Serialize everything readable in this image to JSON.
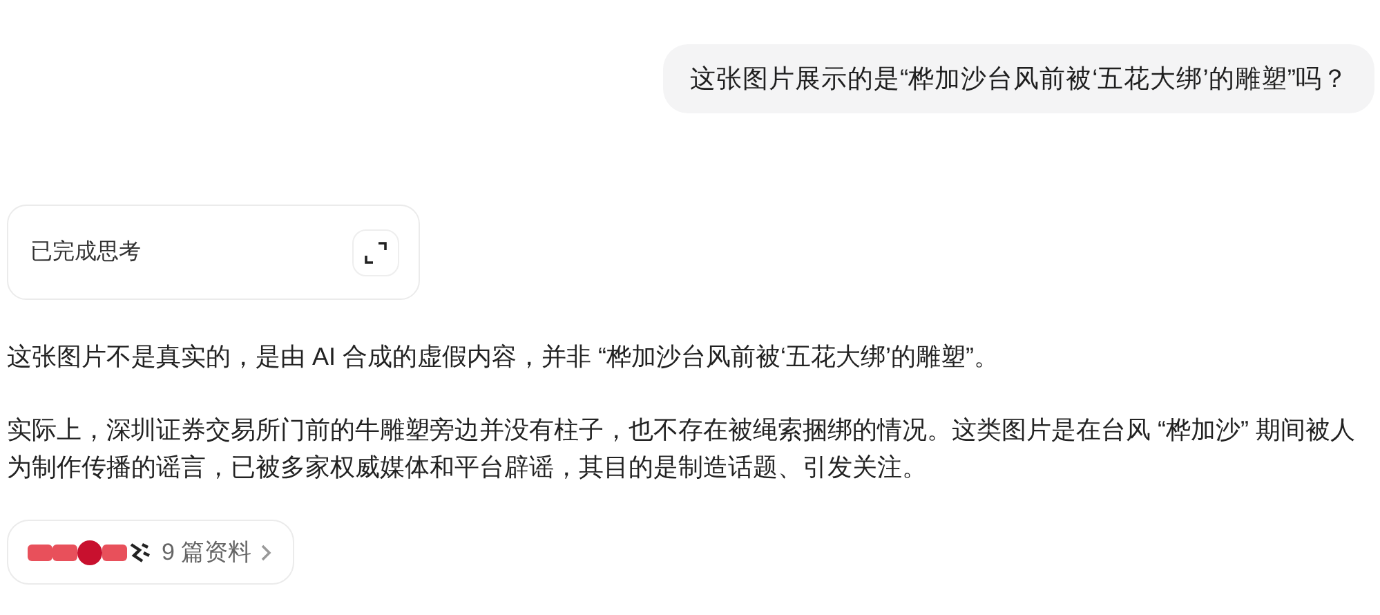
{
  "user_message": {
    "text": "这张图片展示的是“桦加沙台风前被‘五花大绑’的雕塑”吗？"
  },
  "thinking": {
    "label": "已完成思考",
    "expanded": false
  },
  "answer": {
    "paragraphs": [
      "这张图片不是真实的，是由 AI 合成的虚假内容，并非 “桦加沙台风前被‘五花大绑’的雕塑”。",
      "实际上，深圳证券交易所门前的牛雕塑旁边并没有柱子，也不存在被绳索捆绑的情况。这类图片是在台风 “桦加沙” 期间被人为制作传播的谣言，已被多家权威媒体和平台辟谣，其目的是制造话题、引发关注。"
    ]
  },
  "sources": {
    "label": "9 篇资料",
    "logos": [
      {
        "color": "#e8505b"
      },
      {
        "color": "#e8505b"
      },
      {
        "color": "#c8102e"
      },
      {
        "color": "#e8505b"
      },
      {
        "color": "#222222"
      }
    ]
  }
}
